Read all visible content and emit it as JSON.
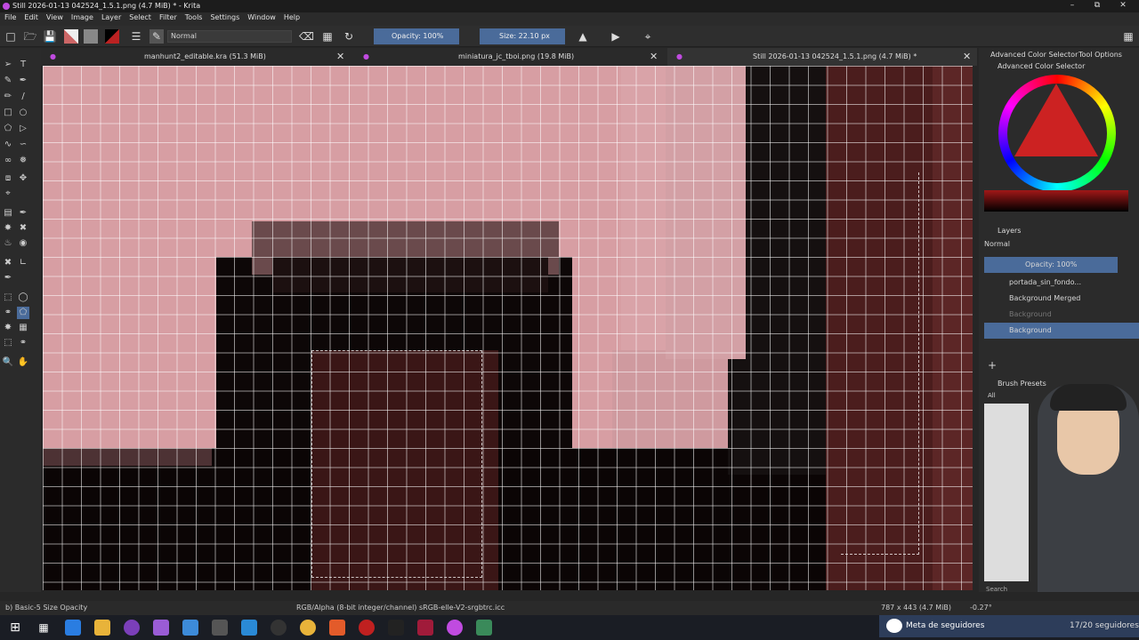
{
  "window": {
    "title": "Still 2026-01-13 042524_1.5.1.png (4.7 MiB) * - Krita"
  },
  "menu": [
    "File",
    "Edit",
    "View",
    "Image",
    "Layer",
    "Select",
    "Filter",
    "Tools",
    "Settings",
    "Window",
    "Help"
  ],
  "toolbar": {
    "blend_mode": "Normal",
    "opacity": "Opacity: 100%",
    "size": "Size: 22.10 px"
  },
  "tabs": [
    {
      "label": "manhunt2_editable.kra (51.3 MiB)"
    },
    {
      "label": "miniatura_jc_tboi.png (19.8 MiB)"
    },
    {
      "label": "Still 2026-01-13 042524_1.5.1.png (4.7 MiB) *"
    }
  ],
  "right_panel": {
    "tab_color": "Advanced Color Selector",
    "tab_tool": "Tool Options",
    "color_title": "Advanced Color Selector",
    "layers_title": "Layers",
    "layers_blend": "Normal",
    "layers_opacity": "Opacity:  100%",
    "layers": [
      {
        "name": "portada_sin_fondo...",
        "visible": true
      },
      {
        "name": "Background Merged",
        "visible": true
      },
      {
        "name": "Background",
        "visible": false
      },
      {
        "name": "Background",
        "visible": true,
        "selected": true
      }
    ],
    "presets_title": "Brush Presets",
    "presets_filter": "All",
    "search_placeholder": "Search"
  },
  "status": {
    "preset": "b) Basic-5 Size Opacity",
    "color_info": "RGB/Alpha (8-bit integer/channel)  sRGB-elle-V2-srgbtrc.icc",
    "dims": "787 x 443 (4.7 MiB)",
    "rotation": "-0.27°"
  },
  "notification": {
    "label": "Meta de seguidores",
    "value": "17/20 seguidores"
  },
  "colors": {
    "accent": "#4a6b9a",
    "pink": "#d79ea3",
    "dark_red": "#4a1a1a"
  }
}
